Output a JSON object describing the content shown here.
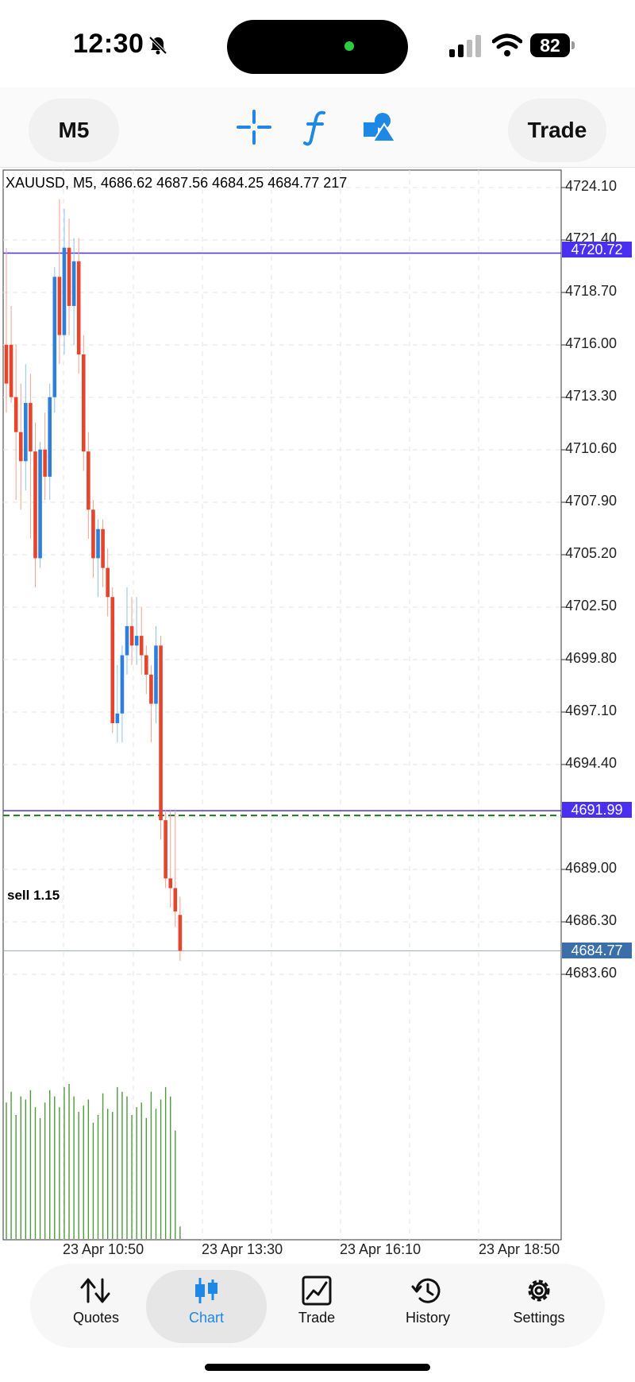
{
  "status_bar": {
    "time": "12:30",
    "battery": "82"
  },
  "toolbar": {
    "timeframe": "M5",
    "trade_label": "Trade",
    "icons": [
      "crosshair-icon",
      "function-icon",
      "shapes-icon"
    ]
  },
  "chart": {
    "header": "XAUUSD, M5, 4686.62 4687.56 4684.25 4684.77 217",
    "price_axis": [
      "4724.10",
      "4721.40",
      "4718.70",
      "4716.00",
      "4713.30",
      "4710.60",
      "4707.90",
      "4705.20",
      "4702.50",
      "4699.80",
      "4697.10",
      "4694.40",
      "4689.00",
      "4686.30",
      "4683.60"
    ],
    "tags": {
      "upper_line": "4720.72",
      "order_line": "4691.99",
      "current_price": "4684.77"
    },
    "order_label": "sell 1.15",
    "time_axis": [
      "23 Apr 10:50",
      "23 Apr 13:30",
      "23 Apr 16:10",
      "23 Apr 18:50"
    ],
    "colors": {
      "bull": "#2e7fd9",
      "bear": "#e5442d",
      "volume": "#4c9a3c",
      "level_line": "#4a2ff0",
      "order_dashed": "#1f7a1f"
    }
  },
  "chart_data": {
    "type": "candlestick",
    "symbol": "XAUUSD",
    "timeframe": "M5",
    "ohlc_last": {
      "open": 4686.62,
      "high": 4687.56,
      "low": 4684.25,
      "close": 4684.77,
      "volume": 217
    },
    "ylim": [
      4683.6,
      4724.1
    ],
    "candles": [
      {
        "o": 4716.0,
        "h": 4721.0,
        "l": 4712.5,
        "c": 4714.0
      },
      {
        "o": 4716.0,
        "h": 4718.0,
        "l": 4713.0,
        "c": 4713.3
      },
      {
        "o": 4713.3,
        "h": 4716.0,
        "l": 4708.0,
        "c": 4711.5
      },
      {
        "o": 4711.5,
        "h": 4714.0,
        "l": 4707.5,
        "c": 4710.0
      },
      {
        "o": 4710.0,
        "h": 4715.0,
        "l": 4708.5,
        "c": 4713.0
      },
      {
        "o": 4713.0,
        "h": 4714.5,
        "l": 4706.0,
        "c": 4710.5
      },
      {
        "o": 4710.5,
        "h": 4712.0,
        "l": 4703.5,
        "c": 4705.0
      },
      {
        "o": 4705.0,
        "h": 4711.0,
        "l": 4704.5,
        "c": 4710.6
      },
      {
        "o": 4710.6,
        "h": 4712.5,
        "l": 4708.0,
        "c": 4709.2
      },
      {
        "o": 4709.2,
        "h": 4714.0,
        "l": 4708.0,
        "c": 4713.3
      },
      {
        "o": 4713.3,
        "h": 4720.0,
        "l": 4712.5,
        "c": 4719.5
      },
      {
        "o": 4719.5,
        "h": 4723.5,
        "l": 4715.0,
        "c": 4716.5
      },
      {
        "o": 4716.5,
        "h": 4723.0,
        "l": 4715.5,
        "c": 4721.0
      },
      {
        "o": 4721.0,
        "h": 4722.5,
        "l": 4716.5,
        "c": 4718.0
      },
      {
        "o": 4718.0,
        "h": 4721.5,
        "l": 4716.0,
        "c": 4720.3
      },
      {
        "o": 4720.3,
        "h": 4721.5,
        "l": 4714.5,
        "c": 4715.5
      },
      {
        "o": 4715.5,
        "h": 4716.5,
        "l": 4709.5,
        "c": 4710.5
      },
      {
        "o": 4710.5,
        "h": 4711.5,
        "l": 4706.0,
        "c": 4707.5
      },
      {
        "o": 4707.5,
        "h": 4708.0,
        "l": 4704.0,
        "c": 4705.0
      },
      {
        "o": 4705.0,
        "h": 4707.0,
        "l": 4703.0,
        "c": 4706.5
      },
      {
        "o": 4706.5,
        "h": 4707.0,
        "l": 4703.5,
        "c": 4704.5
      },
      {
        "o": 4704.5,
        "h": 4705.5,
        "l": 4702.0,
        "c": 4703.0
      },
      {
        "o": 4703.0,
        "h": 4703.5,
        "l": 4696.0,
        "c": 4696.5
      },
      {
        "o": 4696.5,
        "h": 4699.5,
        "l": 4695.5,
        "c": 4697.0
      },
      {
        "o": 4697.0,
        "h": 4700.5,
        "l": 4695.5,
        "c": 4700.0
      },
      {
        "o": 4700.0,
        "h": 4703.5,
        "l": 4699.0,
        "c": 4701.5
      },
      {
        "o": 4701.5,
        "h": 4703.0,
        "l": 4699.5,
        "c": 4700.5
      },
      {
        "o": 4700.5,
        "h": 4703.0,
        "l": 4699.5,
        "c": 4701.0
      },
      {
        "o": 4701.0,
        "h": 4702.5,
        "l": 4699.0,
        "c": 4700.0
      },
      {
        "o": 4700.0,
        "h": 4700.5,
        "l": 4698.0,
        "c": 4699.0
      },
      {
        "o": 4699.0,
        "h": 4699.5,
        "l": 4695.5,
        "c": 4697.5
      },
      {
        "o": 4697.5,
        "h": 4701.5,
        "l": 4696.5,
        "c": 4700.5
      },
      {
        "o": 4700.5,
        "h": 4701.0,
        "l": 4690.5,
        "c": 4691.5
      },
      {
        "o": 4691.5,
        "h": 4692.0,
        "l": 4688.0,
        "c": 4688.5
      },
      {
        "o": 4688.5,
        "h": 4692.0,
        "l": 4687.0,
        "c": 4688.0
      },
      {
        "o": 4688.0,
        "h": 4692.0,
        "l": 4686.0,
        "c": 4686.8
      },
      {
        "o": 4686.62,
        "h": 4687.56,
        "l": 4684.25,
        "c": 4684.77
      }
    ],
    "volumes": [
      88,
      95,
      80,
      92,
      90,
      96,
      85,
      78,
      88,
      96,
      92,
      85,
      98,
      100,
      92,
      82,
      86,
      90,
      75,
      80,
      94,
      84,
      82,
      98,
      95,
      92,
      80,
      85,
      88,
      78,
      95,
      84,
      90,
      98,
      92,
      70,
      8
    ],
    "levels": [
      4720.72,
      4691.99
    ]
  }
}
